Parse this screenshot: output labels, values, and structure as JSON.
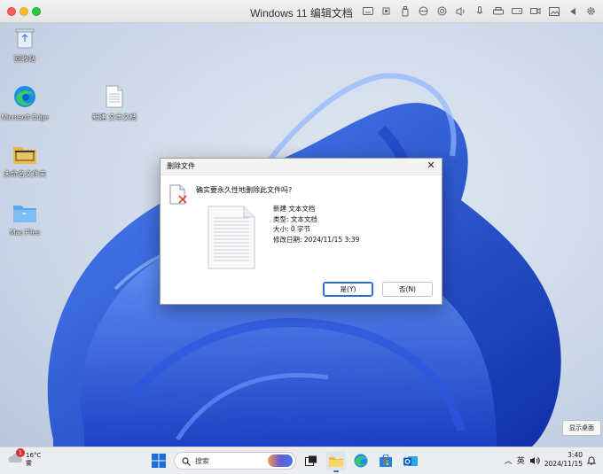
{
  "window": {
    "title": "Windows 11 编辑文档"
  },
  "desktop_icons": [
    {
      "label": "回收站",
      "icon": "recycle-bin-icon"
    },
    {
      "label": "Microsoft Edge",
      "icon": "edge-icon"
    },
    {
      "label": "新建 文本文档",
      "icon": "text-document-icon"
    },
    {
      "label": "未命名文件夹",
      "icon": "folder-icon"
    },
    {
      "label": "Mac Files",
      "icon": "mac-folder-icon"
    }
  ],
  "dialog": {
    "title": "删除文件",
    "question": "确实要永久性地删除此文件吗?",
    "file_name": "新建 文本文档",
    "file_type": "类型: 文本文档",
    "file_size": "大小: 0 字节",
    "modified": "修改日期: 2024/11/15 3:39",
    "yes_label": "是(Y)",
    "no_label": "否(N)"
  },
  "show_desktop": "显示桌面",
  "taskbar": {
    "weather_temp": "16°C",
    "weather_desc": "雾",
    "notif_count": "1",
    "search_placeholder": "搜索",
    "ime": "英",
    "time": "3:40",
    "date": "2024/11/15"
  },
  "colors": {
    "accent": "#2f6fcc",
    "wallpaper_blue": "#1f4fd8"
  }
}
